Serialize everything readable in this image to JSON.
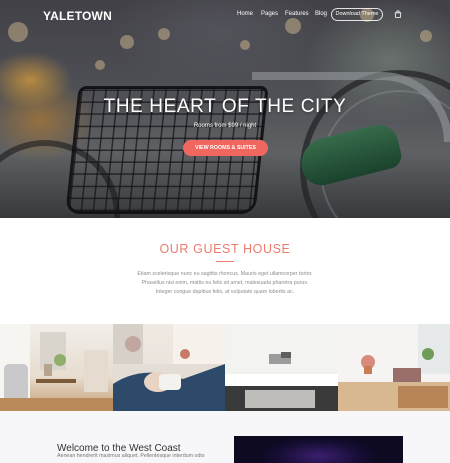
{
  "nav": {
    "logo": "YALETOWN",
    "menu": [
      "Home",
      "Pages",
      "Features",
      "Blog"
    ],
    "cta_label": "Download Theme",
    "cart_icon": "shopping-bag-icon"
  },
  "hero": {
    "title": "THE HEART OF THE CITY",
    "subtitle": "Rooms from $99 / night",
    "button_label": "VIEW ROOMS & SUITES",
    "button_color": "#f0675f"
  },
  "guest_house": {
    "title": "OUR GUEST HOUSE",
    "accent_color": "#ea7c6d",
    "lines": [
      "Etiam scelerisque nunc eu sagittis rhoncus. Mauris eget ullamcorper tortor.",
      "Phasellus nisi enim, mattis eu felis sit amet, malesuada pharetra purus.",
      "Integer congue dapibus felis, at vulputate quam lobortis ac."
    ]
  },
  "welcome": {
    "title": "Welcome to the West Coast",
    "text": "Aenean hendrerit maximus aliquet. Pellentesque interdum odio"
  }
}
